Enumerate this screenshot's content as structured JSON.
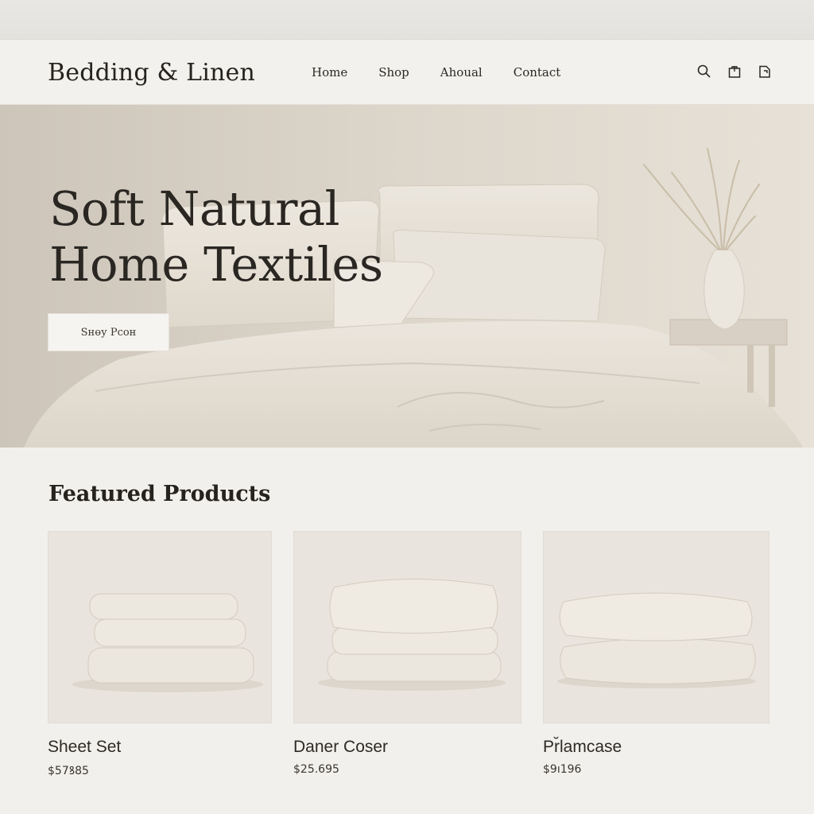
{
  "header": {
    "logo": "Bedding & Linen",
    "nav": [
      "Home",
      "Shop",
      "Ahoual",
      "Contact"
    ],
    "icons": [
      "search-icon",
      "bag-icon",
      "cart-icon"
    ]
  },
  "hero": {
    "title_line1": "Soft Natural",
    "title_line2": "Home Textiles",
    "cta": "Sнөу Рсон"
  },
  "featured": {
    "title": "Featured Products",
    "products": [
      {
        "name": "Sheet Set",
        "price": "$57ꝸ85"
      },
      {
        "name": "Daner Coser",
        "price": "$25.695"
      },
      {
        "name": "Pr̆lamcase",
        "price": "$9ı196"
      }
    ]
  },
  "colors": {
    "background": "#f2f0ec",
    "linen": "#e8e3da",
    "text": "#2b2824"
  }
}
